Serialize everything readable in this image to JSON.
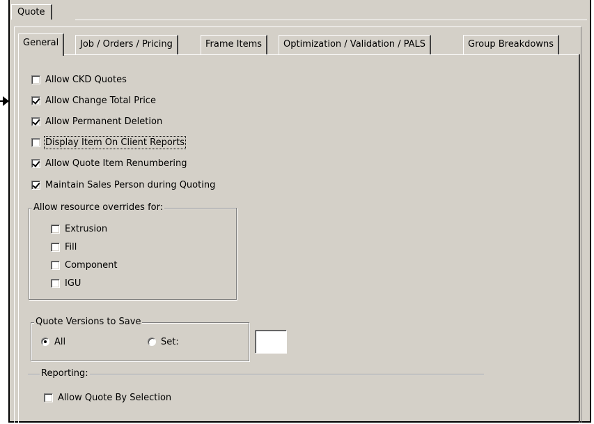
{
  "outer_tab": {
    "label": "Quote"
  },
  "tabs": [
    {
      "label": "General",
      "active": true
    },
    {
      "label": "Job / Orders / Pricing",
      "active": false
    },
    {
      "label": "Frame Items",
      "active": false
    },
    {
      "label": "Optimization / Validation / PALS",
      "active": false
    },
    {
      "label": "Group Breakdowns",
      "active": false
    }
  ],
  "options": [
    {
      "label": "Allow CKD Quotes",
      "checked": false
    },
    {
      "label": "Allow Change Total Price",
      "checked": true
    },
    {
      "label": "Allow Permanent Deletion",
      "checked": true
    },
    {
      "label": "Display Item On Client Reports",
      "checked": false,
      "focused": true
    },
    {
      "label": "Allow Quote Item Renumbering",
      "checked": true
    },
    {
      "label": "Maintain Sales Person during Quoting",
      "checked": true
    }
  ],
  "resource_overrides": {
    "title": "Allow resource overrides for:",
    "items": [
      {
        "label": "Extrusion",
        "checked": false
      },
      {
        "label": "Fill",
        "checked": false
      },
      {
        "label": "Component",
        "checked": false
      },
      {
        "label": "IGU",
        "checked": false
      }
    ]
  },
  "quote_versions": {
    "title": "Quote Versions to Save",
    "all_label": "All",
    "set_label": "Set:",
    "selected": "all",
    "set_value": ""
  },
  "reporting": {
    "title": "Reporting:",
    "allow_by_selection": {
      "label": "Allow Quote By Selection",
      "checked": false
    }
  }
}
